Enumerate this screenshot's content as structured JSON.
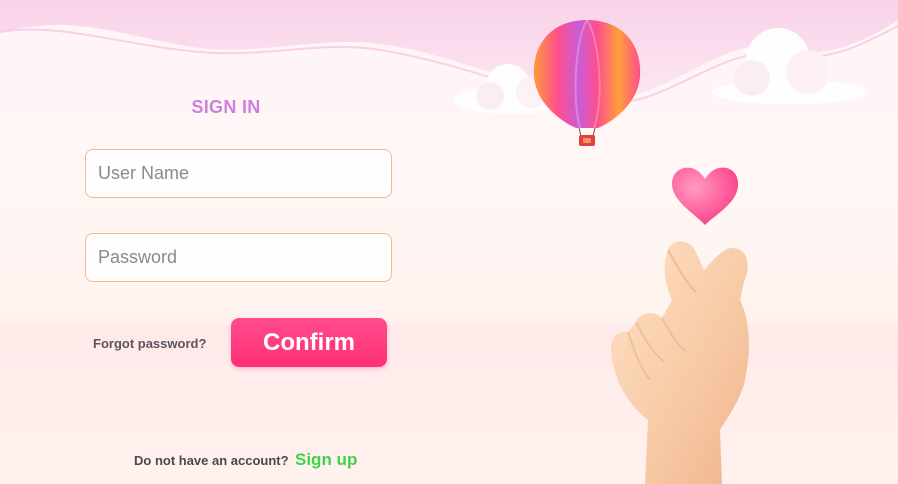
{
  "form": {
    "title": "SIGN IN",
    "username_placeholder": "User Name",
    "password_placeholder": "Password",
    "forgot_label": "Forgot password?",
    "confirm_label": "Confirm"
  },
  "footer": {
    "prompt": "Do not have an account?",
    "signup_label": "Sign up"
  },
  "illustration": {
    "icons": [
      "hot-air-balloon-icon",
      "cloud-icon",
      "heart-icon",
      "finger-heart-hand-icon"
    ]
  },
  "colors": {
    "title": "#cc7fe0",
    "field_border": "#f6b98a",
    "confirm": "#ff3b7f",
    "signup": "#3fd34b",
    "heart": "#ff5c9a"
  }
}
